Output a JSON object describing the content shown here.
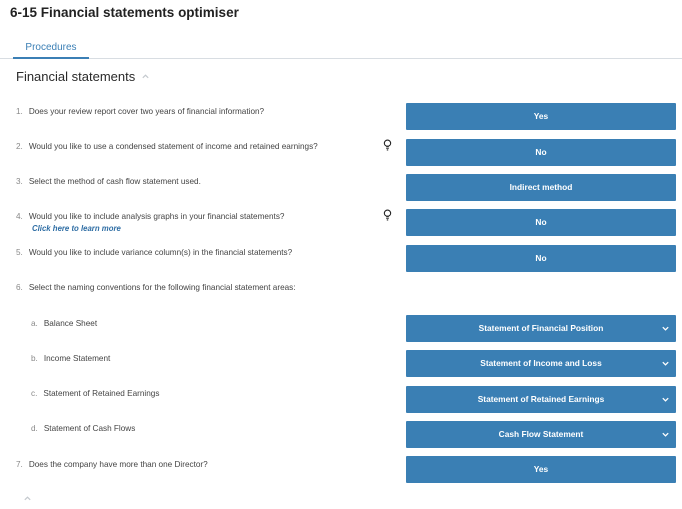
{
  "window": {
    "title": "6-15 Financial statements optimiser"
  },
  "tabs": [
    {
      "label": "Procedures"
    }
  ],
  "section": {
    "title": "Financial statements"
  },
  "learn_more": "Click here to learn more",
  "questions": [
    {
      "num": "1.",
      "text": "Does your review report cover two years of financial information?",
      "answer": "Yes"
    },
    {
      "num": "2.",
      "text": "Would you like to use a condensed statement of income and retained earnings?",
      "answer": "No"
    },
    {
      "num": "3.",
      "text": "Select the method of cash flow statement used.",
      "answer": "Indirect method"
    },
    {
      "num": "4.",
      "text": "Would you like to include analysis graphs in your financial statements?",
      "answer": "No"
    },
    {
      "num": "5.",
      "text": "Would you like to include variance column(s) in the financial statements?",
      "answer": "No"
    },
    {
      "num": "6.",
      "text": "Select the naming conventions for the following financial statement areas:"
    },
    {
      "num": "7.",
      "text": "Does the company have more than one Director?",
      "answer": "Yes"
    }
  ],
  "naming": [
    {
      "num": "a.",
      "text": "Balance Sheet",
      "selected": "Statement of Financial Position"
    },
    {
      "num": "b.",
      "text": "Income Statement",
      "selected": "Statement of Income and Loss"
    },
    {
      "num": "c.",
      "text": "Statement of Retained Earnings",
      "selected": "Statement of Retained Earnings"
    },
    {
      "num": "d.",
      "text": "Statement of Cash Flows",
      "selected": "Cash Flow Statement"
    }
  ],
  "colors": {
    "accent": "#3a7fb4",
    "link": "#2e6da4"
  },
  "icons": {
    "hint": "lightbulb-icon",
    "dropdown": "chevron-down-icon",
    "collapse": "chevron-up-icon"
  }
}
